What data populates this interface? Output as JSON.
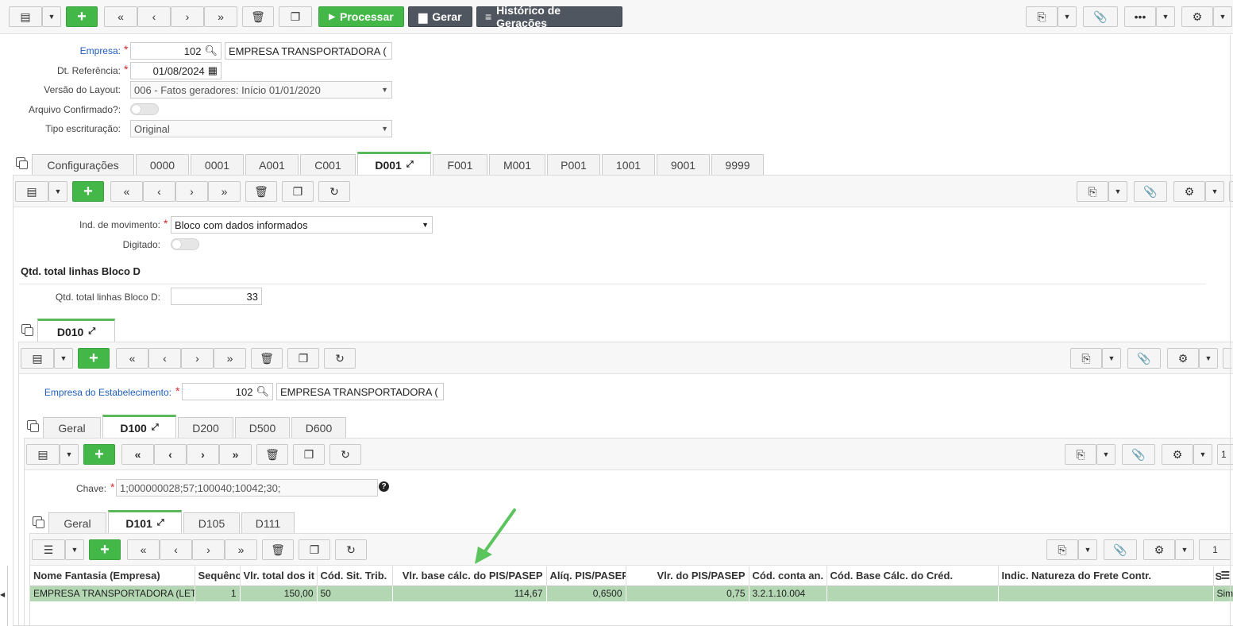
{
  "main_toolbar": {
    "processar_label": "Processar",
    "gerar_label": "Gerar",
    "historico_label": "Histórico de Gerações"
  },
  "form": {
    "empresa": {
      "label": "Empresa:",
      "code": "102",
      "name": "EMPRESA TRANSPORTADORA ("
    },
    "dt_referencia": {
      "label": "Dt. Referência:",
      "value": "01/08/2024"
    },
    "versao_layout": {
      "label": "Versão do Layout:",
      "value": "006 - Fatos geradores: Início 01/01/2020"
    },
    "arquivo_confirmado": {
      "label": "Arquivo Confirmado?:"
    },
    "tipo_escrituracao": {
      "label": "Tipo escrituração:",
      "value": "Original"
    }
  },
  "tabs_main": [
    "Configurações",
    "0000",
    "0001",
    "A001",
    "C001",
    "D001",
    "F001",
    "M001",
    "P001",
    "1001",
    "9001",
    "9999"
  ],
  "d001": {
    "ind_movimento": {
      "label": "Ind. de movimento:",
      "value": "Bloco com dados informados"
    },
    "digitado": {
      "label": "Digitado:"
    },
    "section_title": "Qtd. total linhas Bloco D",
    "qtd_total": {
      "label": "Qtd. total linhas Bloco D:",
      "value": "33"
    }
  },
  "tabs_d010": [
    "D010"
  ],
  "d010": {
    "empresa_estab": {
      "label": "Empresa do Estabelecimento:",
      "code": "102",
      "name": "EMPRESA TRANSPORTADORA ("
    }
  },
  "tabs_d100_group": [
    "Geral",
    "D100",
    "D200",
    "D500",
    "D600"
  ],
  "d100": {
    "chave": {
      "label": "Chave:",
      "value": "1;000000028;57;100040;10042;30;"
    },
    "page_num": "1"
  },
  "tabs_d101_group": [
    "Geral",
    "D101",
    "D105",
    "D111"
  ],
  "d101": {
    "page_num": "1",
    "columns": [
      "Nome Fantasia (Empresa)",
      "Sequência",
      "Vlr. total dos it",
      "Cód. Sit. Trib.",
      "Vlr. base cálc. do PIS/PASEP",
      "Alíq. PIS/PASEP",
      "Vlr. do PIS/PASEP",
      "Cód. conta an.",
      "Cód. Base Cálc. do Créd.",
      "Indic. Natureza do Frete Contr.",
      "Simples"
    ],
    "rows": [
      [
        "EMPRESA TRANSPORTADORA (LET",
        "1",
        "150,00",
        "50",
        "114,67",
        "0,6500",
        "0,75",
        "3.2.1.10.004",
        "",
        "",
        "Sim"
      ]
    ]
  },
  "colors": {
    "accent_green": "#44b749",
    "tab_active_border": "#5cb85c",
    "row_selected": "#b3d7b3",
    "arrow": "#5cc45c",
    "required": "#d9272e",
    "link_blue": "#1f5fbf"
  }
}
